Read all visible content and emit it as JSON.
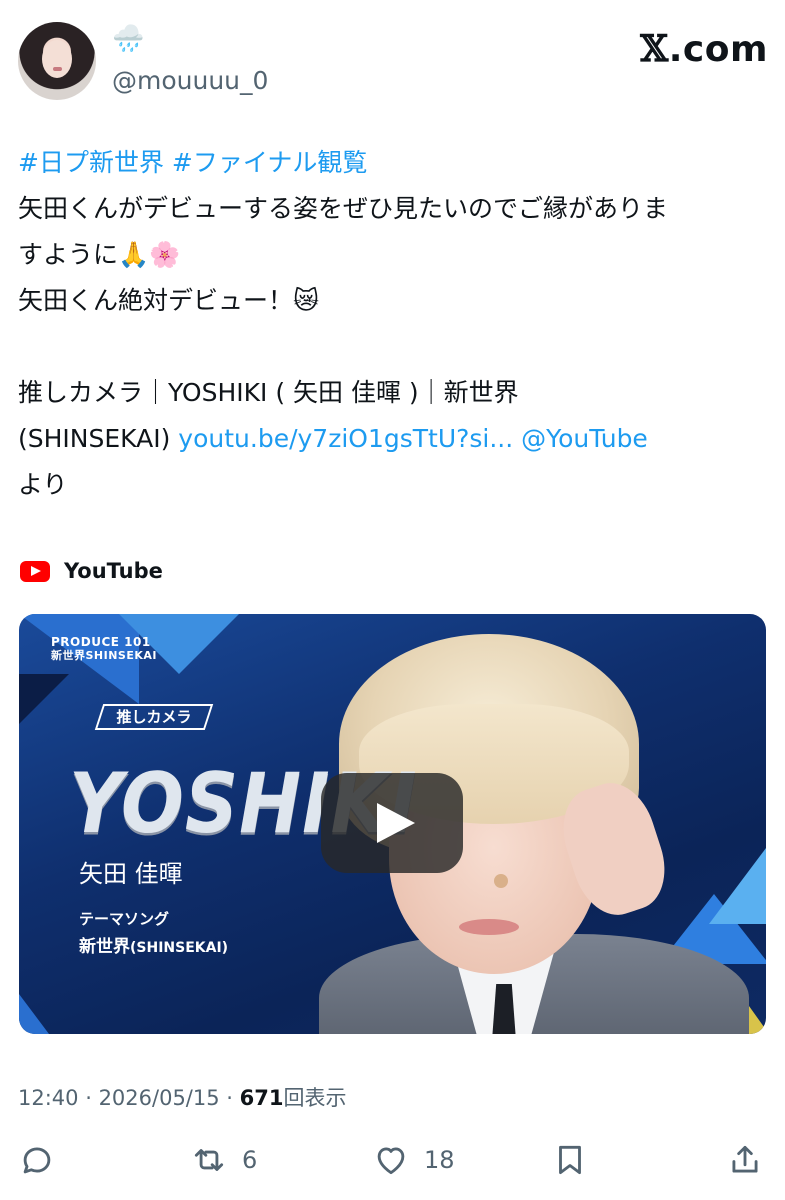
{
  "header": {
    "display_name_emoji": "🌧️",
    "handle": "@mouuuu_0",
    "brand": ".com",
    "brand_x": "𝕏"
  },
  "tweet": {
    "hashtags": [
      "#日プ新世界",
      "#ファイナル観覧"
    ],
    "lines": [
      "矢田くんがデビューする姿をぜひ見たいのでご縁がありま",
      "すように🙏🌸",
      "矢田くん絶対デビュー！😿"
    ],
    "video_line1": "推しカメラ｜YOSHIKI ( 矢田 佳暉 )｜新世界",
    "video_line2_prefix": "(SHINSEKAI) ",
    "link_url": "youtu.be/y7ziO1gsTtU?si...",
    "link_mention": "@YouTube",
    "video_line3": "より"
  },
  "card": {
    "source": "YouTube",
    "thumbnail": {
      "logo_top": "PRODUCE 101",
      "logo_bottom": "新世界SHINSEKAI",
      "badge": "推しカメラ",
      "name": "YOSHIKI",
      "jp_name": "矢田 佳暉",
      "theme_label": "テーマソング",
      "theme_song": "新世界",
      "theme_song_en": "(SHINSEKAI)"
    }
  },
  "meta": {
    "time": "12:40",
    "separator": " · ",
    "date": "2026/05/15",
    "views_count": "671",
    "views_label": "回表示"
  },
  "actions": {
    "retweets": "6",
    "likes": "18"
  },
  "colors": {
    "link": "#1d9bf0",
    "muted": "#536471",
    "text": "#0f1419"
  }
}
